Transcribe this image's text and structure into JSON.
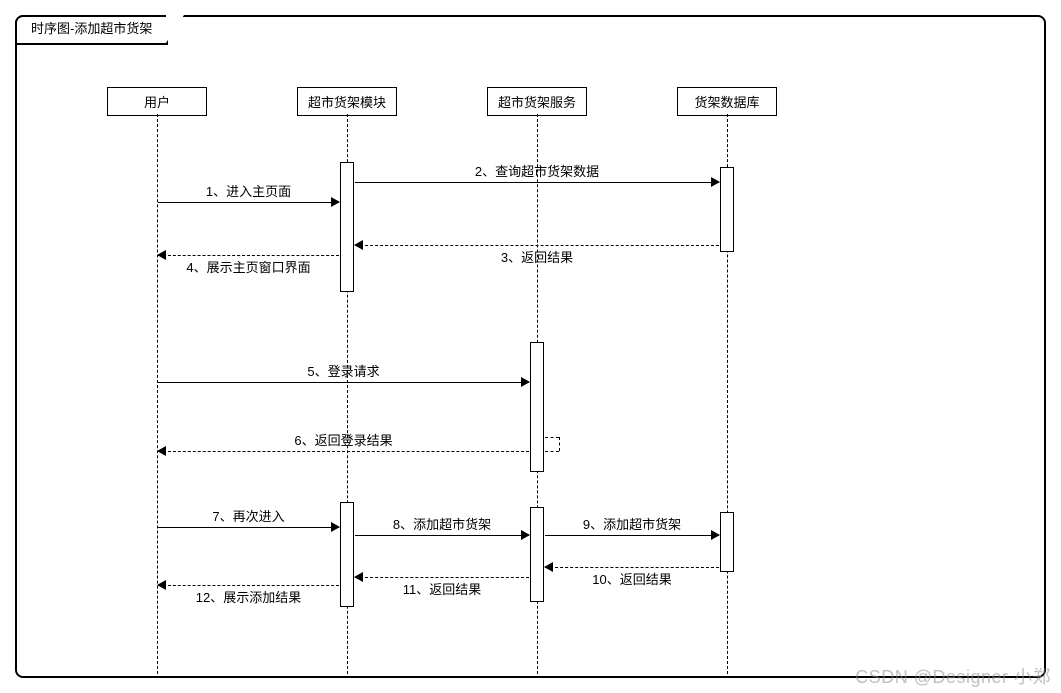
{
  "title": "时序图-添加超市货架",
  "participants": {
    "p1": "用户",
    "p2": "超市货架模块",
    "p3": "超市货架服务",
    "p4": "货架数据库"
  },
  "messages": {
    "m1": "1、进入主页面",
    "m2": "2、查询超市货架数据",
    "m3": "3、返回结果",
    "m4": "4、展示主页窗口界面",
    "m5": "5、登录请求",
    "m6": "6、返回登录结果",
    "m7": "7、再次进入",
    "m8": "8、添加超市货架",
    "m9": "9、添加超市货架",
    "m10": "10、返回结果",
    "m11": "11、返回结果",
    "m12": "12、展示添加结果"
  },
  "watermark": "CSDN @Designer 小郑",
  "chart_data": {
    "type": "sequence-diagram",
    "title": "时序图-添加超市货架",
    "participants": [
      "用户",
      "超市货架模块",
      "超市货架服务",
      "货架数据库"
    ],
    "messages": [
      {
        "from": "用户",
        "to": "超市货架模块",
        "label": "1、进入主页面",
        "style": "solid"
      },
      {
        "from": "超市货架模块",
        "to": "货架数据库",
        "label": "2、查询超市货架数据",
        "style": "solid"
      },
      {
        "from": "货架数据库",
        "to": "超市货架模块",
        "label": "3、返回结果",
        "style": "dashed"
      },
      {
        "from": "超市货架模块",
        "to": "用户",
        "label": "4、展示主页窗口界面",
        "style": "dashed"
      },
      {
        "from": "用户",
        "to": "超市货架服务",
        "label": "5、登录请求",
        "style": "solid"
      },
      {
        "from": "超市货架服务",
        "to": "用户",
        "label": "6、返回登录结果",
        "style": "dashed"
      },
      {
        "from": "用户",
        "to": "超市货架模块",
        "label": "7、再次进入",
        "style": "solid"
      },
      {
        "from": "超市货架模块",
        "to": "超市货架服务",
        "label": "8、添加超市货架",
        "style": "solid"
      },
      {
        "from": "超市货架服务",
        "to": "货架数据库",
        "label": "9、添加超市货架",
        "style": "solid"
      },
      {
        "from": "货架数据库",
        "to": "超市货架服务",
        "label": "10、返回结果",
        "style": "dashed"
      },
      {
        "from": "超市货架服务",
        "to": "超市货架模块",
        "label": "11、返回结果",
        "style": "dashed"
      },
      {
        "from": "超市货架模块",
        "to": "用户",
        "label": "12、展示添加结果",
        "style": "dashed"
      }
    ]
  }
}
